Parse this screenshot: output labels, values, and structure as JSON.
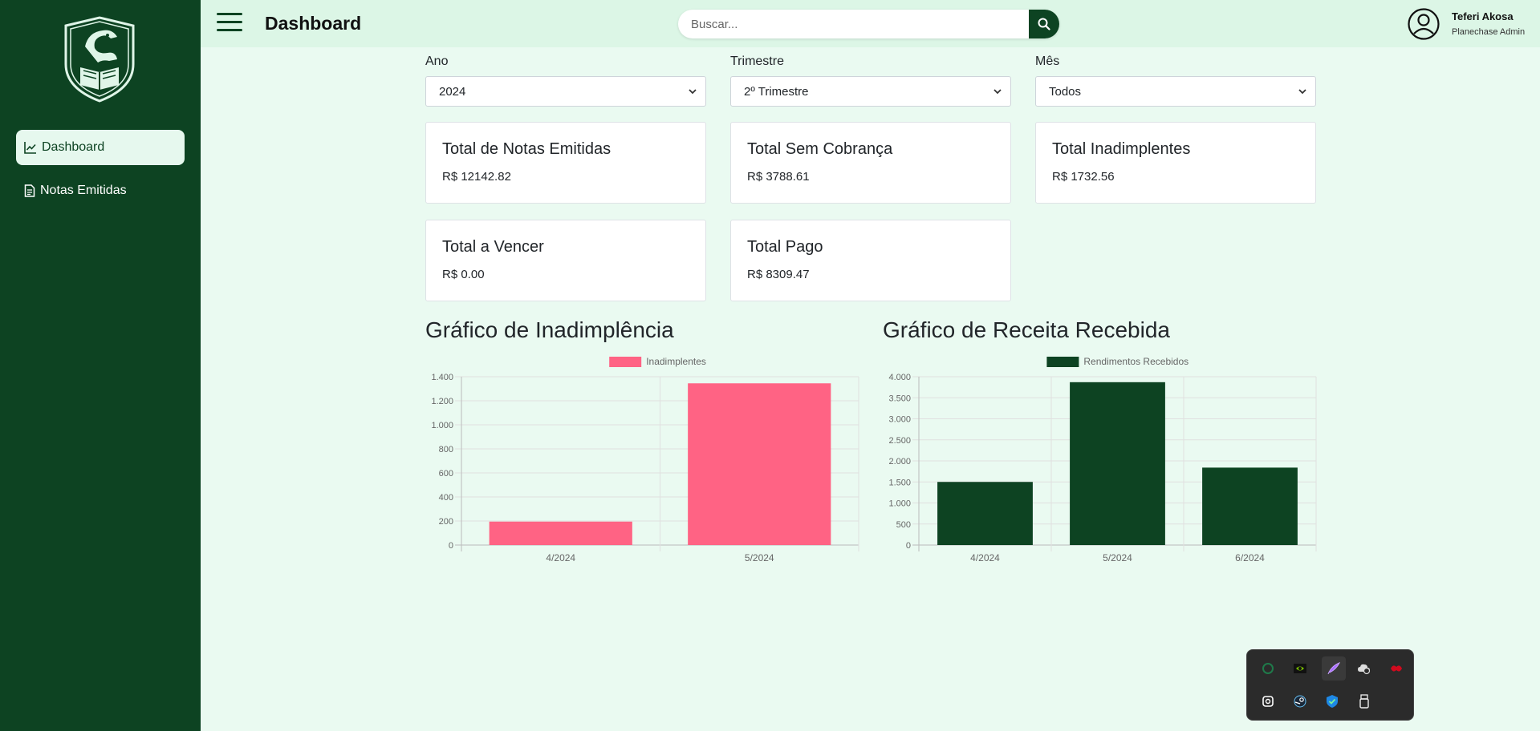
{
  "sidebar": {
    "items": [
      {
        "label": "Dashboard",
        "icon": "chart-line-icon",
        "active": true
      },
      {
        "label": "Notas Emitidas",
        "icon": "file-text-icon",
        "active": false
      }
    ]
  },
  "header": {
    "title": "Dashboard",
    "search_placeholder": "Buscar...",
    "user_name": "Teferi Akosa",
    "user_role": "Planechase Admin"
  },
  "filters": [
    {
      "label": "Ano",
      "value": "2024"
    },
    {
      "label": "Trimestre",
      "value": "2º Trimestre"
    },
    {
      "label": "Mês",
      "value": "Todos"
    }
  ],
  "cards": [
    {
      "title": "Total de Notas Emitidas",
      "value": "R$ 12142.82"
    },
    {
      "title": "Total Sem Cobrança",
      "value": "R$ 3788.61"
    },
    {
      "title": "Total Inadimplentes",
      "value": "R$ 1732.56"
    },
    {
      "title": "Total a Vencer",
      "value": "R$ 0.00"
    },
    {
      "title": "Total Pago",
      "value": "R$ 8309.47"
    }
  ],
  "colors": {
    "primary": "#0d4322",
    "light": "#eafaf1",
    "pink": "#ff6384"
  },
  "chart_data": [
    {
      "type": "bar",
      "title": "Gráfico de Inadimplência",
      "categories": [
        "4/2024",
        "5/2024"
      ],
      "series": [
        {
          "name": "Inadimplentes",
          "values": [
            195,
            1345
          ],
          "color": "#ff6384"
        }
      ],
      "yticks": [
        "0",
        "200",
        "400",
        "600",
        "800",
        "1.000",
        "1.200",
        "1.400"
      ],
      "ylim": [
        0,
        1400
      ],
      "legend": "top-center",
      "grid": true
    },
    {
      "type": "bar",
      "title": "Gráfico de Receita Recebida",
      "categories": [
        "4/2024",
        "5/2024",
        "6/2024"
      ],
      "series": [
        {
          "name": "Rendimentos Recebidos",
          "values": [
            1500,
            3870,
            1840
          ],
          "color": "#0d4322"
        }
      ],
      "yticks": [
        "0",
        "500",
        "1.000",
        "1.500",
        "2.000",
        "2.500",
        "3.000",
        "3.500",
        "4.000"
      ],
      "ylim": [
        0,
        4000
      ],
      "legend": "top-center",
      "grid": true
    }
  ],
  "tray": {
    "icons": [
      "green-circle-icon",
      "nvidia-icon",
      "feather-icon",
      "cloud-sync-icon",
      "red-app-icon",
      "camera-app-icon",
      "steam-icon",
      "shield-icon",
      "usb-drive-icon"
    ]
  }
}
